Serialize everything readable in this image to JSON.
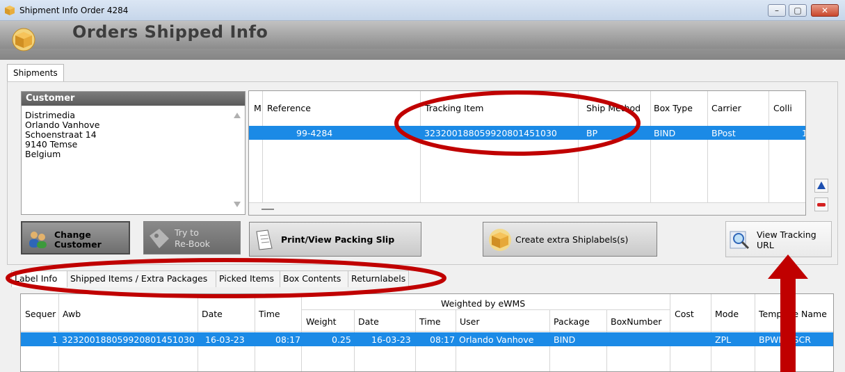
{
  "window": {
    "title": "Shipment Info Order 4284",
    "minimize": "–",
    "maximize": "▢",
    "close": "✕"
  },
  "banner": {
    "title": "Orders Shipped Info"
  },
  "tabs": [
    {
      "label": "Shipments"
    }
  ],
  "customer": {
    "header": "Customer",
    "lines": [
      "Distrimedia",
      "Orlando Vanhove",
      "Schoenstraat 14",
      "9140  Temse",
      "Belgium"
    ]
  },
  "shipments_grid": {
    "columns": [
      "M",
      "Reference",
      "Tracking Item",
      "Ship Method",
      "Box Type",
      "Carrier",
      "Colli"
    ],
    "rows": [
      {
        "reference": "99-4284",
        "tracking": "323200188059920801451030",
        "ship_method": "BP",
        "box_type": "BIND",
        "carrier": "BPost",
        "colli": "1"
      }
    ]
  },
  "buttons": {
    "change_customer": "Change\nCustomer",
    "change_customer_l1": "Change",
    "change_customer_l2": "Customer",
    "rebook_l1": "Try to",
    "rebook_l2": "Re-Book",
    "print": "Print/View Packing Slip",
    "extra_labels": "Create extra Shiplabels(s)",
    "view_tracking_l1": "View Tracking",
    "view_tracking_l2": "URL"
  },
  "subtabs": [
    "Label Info",
    "Shipped Items / Extra Packages",
    "Picked Items",
    "Box Contents",
    "Returnlabels"
  ],
  "label_grid": {
    "group_header": "Weighted by eWMS",
    "columns": [
      "Sequer",
      "Awb",
      "Date",
      "Time",
      "Weight",
      "Date",
      "Time",
      "User",
      "Package",
      "BoxNumber",
      "Cost",
      "Mode",
      "Template Name"
    ],
    "rows": [
      {
        "seq": "1",
        "awb": "323200188059920801451030",
        "date": "16-03-23",
        "time": "08:17",
        "weight": "0.25",
        "wdate": "16-03-23",
        "wtime": "08:17",
        "user": "Orlando Vanhove",
        "package": "BIND",
        "boxnumber": "",
        "cost": "",
        "mode": "ZPL",
        "template": "BPWEL_SCR"
      }
    ]
  },
  "annotations": {
    "color": "#c00000"
  }
}
